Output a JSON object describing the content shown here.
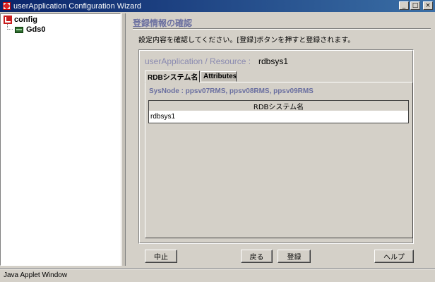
{
  "window": {
    "title": "userApplication Configuration Wizard",
    "buttons": {
      "minimize": "_",
      "maximize": "□",
      "close": "×"
    }
  },
  "tree": {
    "root": {
      "label": "config",
      "icon": "config-icon"
    },
    "children": [
      {
        "label": "Gds0",
        "icon": "disk-icon"
      }
    ]
  },
  "panel": {
    "heading": "登録情報の確認",
    "description": "設定内容を確認してください。[登録]ボタンを押すと登録されます。",
    "resource_label": "userApplication / Resource  :",
    "resource_value": "rdbsys1",
    "tabs": [
      {
        "label": "RDBシステム名",
        "active": true
      },
      {
        "label": "Attributes",
        "active": false
      }
    ],
    "sysnode": "SysNode : ppsv07RMS, ppsv08RMS, ppsv09RMS",
    "table": {
      "header": "RDBシステム名",
      "rows": [
        "rdbsys1"
      ]
    }
  },
  "buttons": {
    "cancel": "中止",
    "back": "戻る",
    "register": "登録",
    "help": "ヘルプ"
  },
  "status": {
    "text": "Java Applet Window"
  },
  "colors": {
    "title_bar": "#0a246a",
    "heading": "#6a6fa0",
    "background": "#d4d0c8"
  }
}
